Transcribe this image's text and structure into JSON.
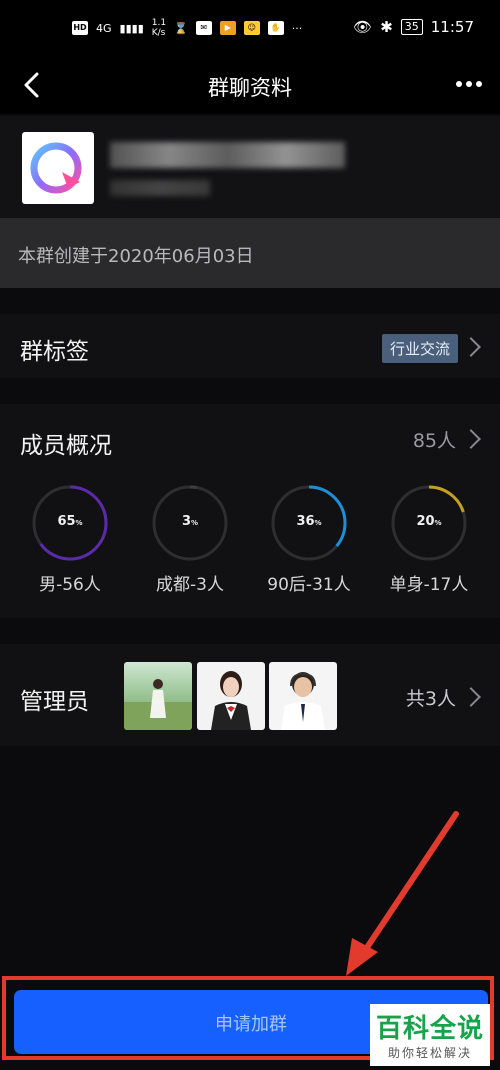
{
  "status_bar": {
    "signal_left": "HD",
    "network": "4G",
    "speed": "1.1\nK/s",
    "battery": "35",
    "time": "11:57"
  },
  "header": {
    "title": "群聊资料"
  },
  "group": {
    "created": "本群创建于2020年06月03日"
  },
  "tags_row": {
    "title": "群标签",
    "tag": "行业交流"
  },
  "members": {
    "title": "成员概况",
    "count": "85人",
    "stats": [
      {
        "value": "65",
        "unit": "%",
        "label": "男-56人",
        "color": "#5b2aa8",
        "fraction": 0.65
      },
      {
        "value": "3",
        "unit": "%",
        "label": "成都-3人",
        "color": "#3d3d40",
        "fraction": 0.03
      },
      {
        "value": "36",
        "unit": "%",
        "label": "90后-31人",
        "color": "#1c8fd6",
        "fraction": 0.36
      },
      {
        "value": "20",
        "unit": "%",
        "label": "单身-17人",
        "color": "#c2a020",
        "fraction": 0.2
      }
    ]
  },
  "admins": {
    "title": "管理员",
    "count": "共3人"
  },
  "apply_button": {
    "label": "申请加群"
  },
  "watermark": {
    "main": "百科全说",
    "sub": "助你轻松解决"
  },
  "colors": {
    "accent": "#1560ff",
    "highlight_frame": "#e23b2e"
  }
}
